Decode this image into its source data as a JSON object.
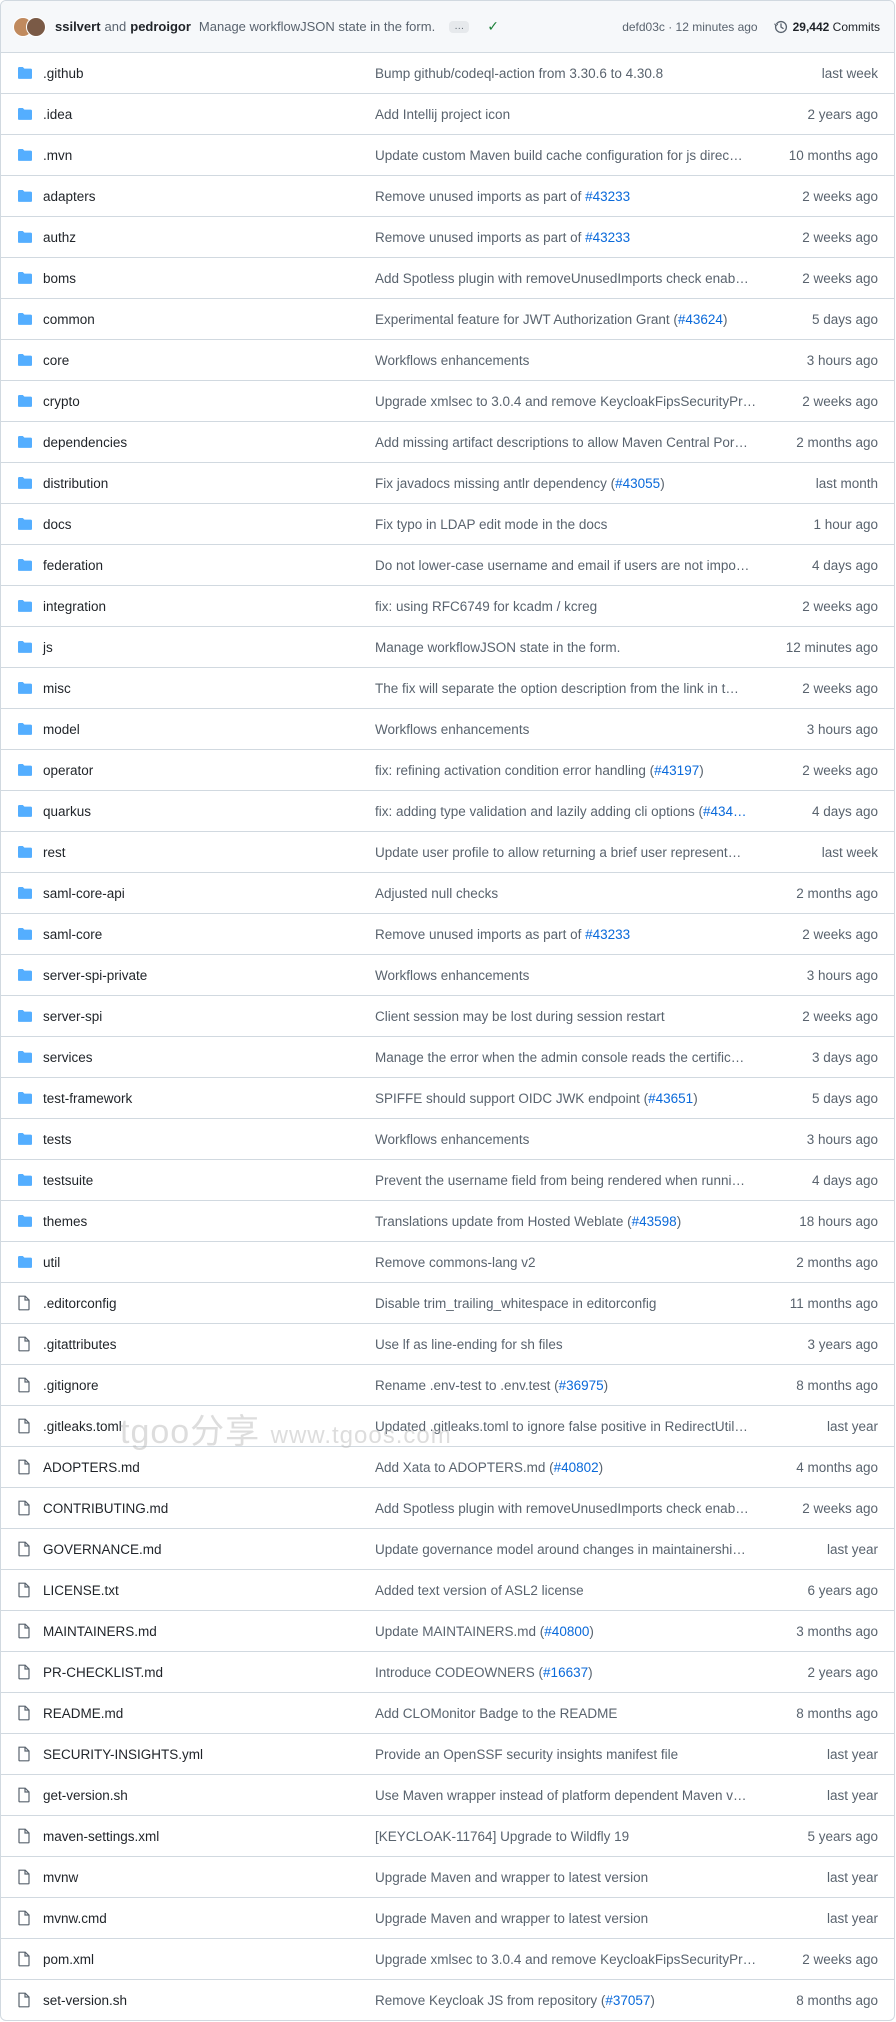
{
  "commit_bar": {
    "author1": "ssilvert",
    "and": "and",
    "author2": "pedroigor",
    "message": "Manage workflowJSON state in the form.",
    "ellipsis": "…",
    "sha_time": "defd03c · 12 minutes ago",
    "commits_count": "29,442",
    "commits_label": "Commits"
  },
  "watermark": {
    "text_a": "tgoo分享",
    "text_b": "www.tgoos.com"
  },
  "rows": [
    {
      "type": "folder",
      "name": ".github",
      "msg": "Bump github/codeql-action from 3.30.6 to 4.30.8",
      "pr": "",
      "suffix": "",
      "date": "last week"
    },
    {
      "type": "folder",
      "name": ".idea",
      "msg": "Add Intellij project icon",
      "pr": "",
      "suffix": "",
      "date": "2 years ago"
    },
    {
      "type": "folder",
      "name": ".mvn",
      "msg": "Update custom Maven build cache configuration for js direc…",
      "pr": "",
      "suffix": "",
      "date": "10 months ago"
    },
    {
      "type": "folder",
      "name": "adapters",
      "msg": "Remove unused imports as part of ",
      "pr": "#43233",
      "suffix": "",
      "date": "2 weeks ago"
    },
    {
      "type": "folder",
      "name": "authz",
      "msg": "Remove unused imports as part of ",
      "pr": "#43233",
      "suffix": "",
      "date": "2 weeks ago"
    },
    {
      "type": "folder",
      "name": "boms",
      "msg": "Add Spotless plugin with removeUnusedImports check enab…",
      "pr": "",
      "suffix": "",
      "date": "2 weeks ago"
    },
    {
      "type": "folder",
      "name": "common",
      "msg": "Experimental feature for JWT Authorization Grant (",
      "pr": "#43624",
      "suffix": ")",
      "date": "5 days ago"
    },
    {
      "type": "folder",
      "name": "core",
      "msg": "Workflows enhancements",
      "pr": "",
      "suffix": "",
      "date": "3 hours ago"
    },
    {
      "type": "folder",
      "name": "crypto",
      "msg": "Upgrade xmlsec to 3.0.4 and remove KeycloakFipsSecurityPr…",
      "pr": "",
      "suffix": "",
      "date": "2 weeks ago"
    },
    {
      "type": "folder",
      "name": "dependencies",
      "msg": "Add missing artifact descriptions to allow Maven Central Por…",
      "pr": "",
      "suffix": "",
      "date": "2 months ago"
    },
    {
      "type": "folder",
      "name": "distribution",
      "msg": "Fix javadocs missing antlr dependency (",
      "pr": "#43055",
      "suffix": ")",
      "date": "last month"
    },
    {
      "type": "folder",
      "name": "docs",
      "msg": "Fix typo in LDAP edit mode in the docs",
      "pr": "",
      "suffix": "",
      "date": "1 hour ago"
    },
    {
      "type": "folder",
      "name": "federation",
      "msg": "Do not lower-case username and email if users are not impo…",
      "pr": "",
      "suffix": "",
      "date": "4 days ago"
    },
    {
      "type": "folder",
      "name": "integration",
      "msg": "fix: using RFC6749 for kcadm / kcreg",
      "pr": "",
      "suffix": "",
      "date": "2 weeks ago"
    },
    {
      "type": "folder",
      "name": "js",
      "msg": "Manage workflowJSON state in the form.",
      "pr": "",
      "suffix": "",
      "date": "12 minutes ago"
    },
    {
      "type": "folder",
      "name": "misc",
      "msg": "The fix will separate the option description from the link in t…",
      "pr": "",
      "suffix": "",
      "date": "2 weeks ago"
    },
    {
      "type": "folder",
      "name": "model",
      "msg": "Workflows enhancements",
      "pr": "",
      "suffix": "",
      "date": "3 hours ago"
    },
    {
      "type": "folder",
      "name": "operator",
      "msg": "fix: refining activation condition error handling (",
      "pr": "#43197",
      "suffix": ")",
      "date": "2 weeks ago"
    },
    {
      "type": "folder",
      "name": "quarkus",
      "msg": "fix: adding type validation and lazily adding cli options (",
      "pr": "#434…",
      "suffix": "",
      "date": "4 days ago"
    },
    {
      "type": "folder",
      "name": "rest",
      "msg": "Update user profile to allow returning a brief user represent…",
      "pr": "",
      "suffix": "",
      "date": "last week"
    },
    {
      "type": "folder",
      "name": "saml-core-api",
      "msg": "Adjusted null checks",
      "pr": "",
      "suffix": "",
      "date": "2 months ago"
    },
    {
      "type": "folder",
      "name": "saml-core",
      "msg": "Remove unused imports as part of ",
      "pr": "#43233",
      "suffix": "",
      "date": "2 weeks ago"
    },
    {
      "type": "folder",
      "name": "server-spi-private",
      "msg": "Workflows enhancements",
      "pr": "",
      "suffix": "",
      "date": "3 hours ago"
    },
    {
      "type": "folder",
      "name": "server-spi",
      "msg": "Client session may be lost during session restart",
      "pr": "",
      "suffix": "",
      "date": "2 weeks ago"
    },
    {
      "type": "folder",
      "name": "services",
      "msg": "Manage the error when the admin console reads the certific…",
      "pr": "",
      "suffix": "",
      "date": "3 days ago"
    },
    {
      "type": "folder",
      "name": "test-framework",
      "msg": "SPIFFE should support OIDC JWK endpoint (",
      "pr": "#43651",
      "suffix": ")",
      "date": "5 days ago"
    },
    {
      "type": "folder",
      "name": "tests",
      "msg": "Workflows enhancements",
      "pr": "",
      "suffix": "",
      "date": "3 hours ago"
    },
    {
      "type": "folder",
      "name": "testsuite",
      "msg": "Prevent the username field from being rendered when runni…",
      "pr": "",
      "suffix": "",
      "date": "4 days ago"
    },
    {
      "type": "folder",
      "name": "themes",
      "msg": "Translations update from Hosted Weblate (",
      "pr": "#43598",
      "suffix": ")",
      "date": "18 hours ago"
    },
    {
      "type": "folder",
      "name": "util",
      "msg": "Remove commons-lang v2",
      "pr": "",
      "suffix": "",
      "date": "2 months ago"
    },
    {
      "type": "file",
      "name": ".editorconfig",
      "msg": "Disable trim_trailing_whitespace in editorconfig",
      "pr": "",
      "suffix": "",
      "date": "11 months ago"
    },
    {
      "type": "file",
      "name": ".gitattributes",
      "msg": "Use lf as line-ending for sh files",
      "pr": "",
      "suffix": "",
      "date": "3 years ago"
    },
    {
      "type": "file",
      "name": ".gitignore",
      "msg": "Rename .env-test to .env.test (",
      "pr": "#36975",
      "suffix": ")",
      "date": "8 months ago"
    },
    {
      "type": "file",
      "name": ".gitleaks.toml",
      "msg": "Updated .gitleaks.toml to ignore false positive in RedirectUtil…",
      "pr": "",
      "suffix": "",
      "date": "last year"
    },
    {
      "type": "file",
      "name": "ADOPTERS.md",
      "msg": "Add Xata to ADOPTERS.md (",
      "pr": "#40802",
      "suffix": ")",
      "date": "4 months ago"
    },
    {
      "type": "file",
      "name": "CONTRIBUTING.md",
      "msg": "Add Spotless plugin with removeUnusedImports check enab…",
      "pr": "",
      "suffix": "",
      "date": "2 weeks ago"
    },
    {
      "type": "file",
      "name": "GOVERNANCE.md",
      "msg": "Update governance model around changes in maintainershi…",
      "pr": "",
      "suffix": "",
      "date": "last year"
    },
    {
      "type": "file",
      "name": "LICENSE.txt",
      "msg": "Added text version of ASL2 license",
      "pr": "",
      "suffix": "",
      "date": "6 years ago"
    },
    {
      "type": "file",
      "name": "MAINTAINERS.md",
      "msg": "Update MAINTAINERS.md (",
      "pr": "#40800",
      "suffix": ")",
      "date": "3 months ago"
    },
    {
      "type": "file",
      "name": "PR-CHECKLIST.md",
      "msg": "Introduce CODEOWNERS (",
      "pr": "#16637",
      "suffix": ")",
      "date": "2 years ago"
    },
    {
      "type": "file",
      "name": "README.md",
      "msg": "Add CLOMonitor Badge to the README",
      "pr": "",
      "suffix": "",
      "date": "8 months ago"
    },
    {
      "type": "file",
      "name": "SECURITY-INSIGHTS.yml",
      "msg": "Provide an OpenSSF security insights manifest file",
      "pr": "",
      "suffix": "",
      "date": "last year"
    },
    {
      "type": "file",
      "name": "get-version.sh",
      "msg": "Use Maven wrapper instead of platform dependent Maven v…",
      "pr": "",
      "suffix": "",
      "date": "last year"
    },
    {
      "type": "file",
      "name": "maven-settings.xml",
      "msg": "[KEYCLOAK-11764] Upgrade to Wildfly 19",
      "pr": "",
      "suffix": "",
      "date": "5 years ago"
    },
    {
      "type": "file",
      "name": "mvnw",
      "msg": "Upgrade Maven and wrapper to latest version",
      "pr": "",
      "suffix": "",
      "date": "last year"
    },
    {
      "type": "file",
      "name": "mvnw.cmd",
      "msg": "Upgrade Maven and wrapper to latest version",
      "pr": "",
      "suffix": "",
      "date": "last year"
    },
    {
      "type": "file",
      "name": "pom.xml",
      "msg": "Upgrade xmlsec to 3.0.4 and remove KeycloakFipsSecurityPr…",
      "pr": "",
      "suffix": "",
      "date": "2 weeks ago"
    },
    {
      "type": "file",
      "name": "set-version.sh",
      "msg": "Remove Keycloak JS from repository (",
      "pr": "#37057",
      "suffix": ")",
      "date": "8 months ago"
    }
  ]
}
